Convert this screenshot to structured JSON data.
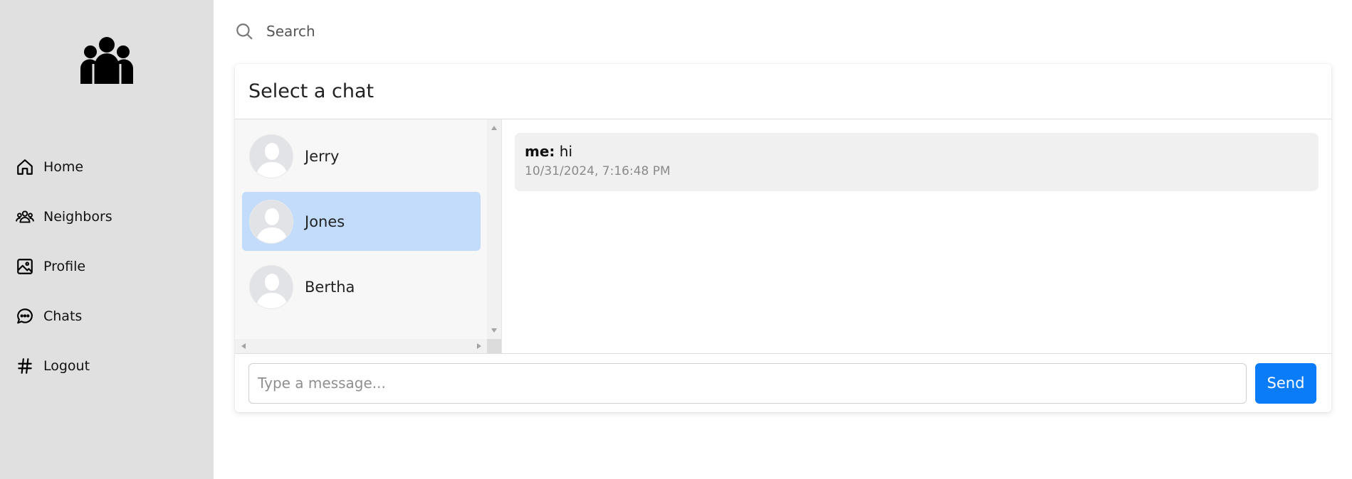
{
  "sidebar": {
    "logo_icon": "people-group-icon",
    "items": [
      {
        "label": "Home",
        "icon": "home-icon"
      },
      {
        "label": "Neighbors",
        "icon": "users-icon"
      },
      {
        "label": "Profile",
        "icon": "image-icon"
      },
      {
        "label": "Chats",
        "icon": "chat-bubble-icon"
      },
      {
        "label": "Logout",
        "icon": "hash-icon"
      }
    ]
  },
  "search": {
    "placeholder": "Search",
    "icon": "search-icon"
  },
  "chat": {
    "title": "Select a chat",
    "contacts": [
      {
        "name": "Jerry",
        "active": false
      },
      {
        "name": "Jones",
        "active": true
      },
      {
        "name": "Bertha",
        "active": false
      }
    ],
    "messages": [
      {
        "sender": "me:",
        "text": "hi",
        "time": "10/31/2024, 7:16:48 PM"
      }
    ],
    "composer": {
      "placeholder": "Type a message...",
      "send_label": "Send"
    }
  },
  "colors": {
    "sidebar_bg": "#e0e0e0",
    "active_contact": "#c3dcfb",
    "send_button": "#0a7cf8"
  }
}
